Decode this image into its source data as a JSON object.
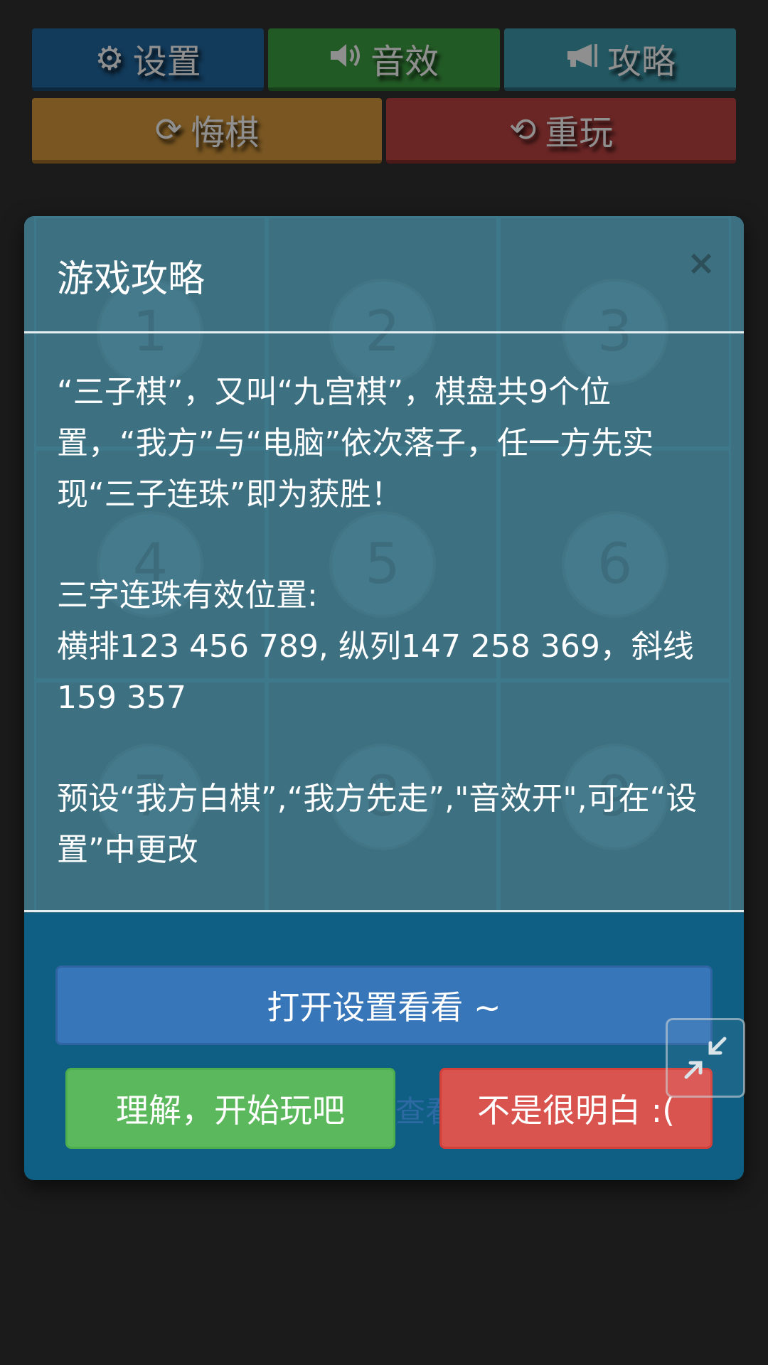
{
  "toolbar": {
    "settings": {
      "label": "设置",
      "icon": "gear-icon"
    },
    "sound": {
      "label": "音效",
      "icon": "volume-icon"
    },
    "guide": {
      "label": "攻略",
      "icon": "megaphone-icon"
    },
    "undo": {
      "label": "悔棋",
      "icon": "rotate-icon"
    },
    "replay": {
      "label": "重玩",
      "icon": "refresh-icon"
    }
  },
  "board": {
    "cells": [
      "1",
      "2",
      "3",
      "4",
      "5",
      "6",
      "7",
      "8",
      "9"
    ]
  },
  "modal": {
    "title": "游戏攻略",
    "close": "×",
    "paragraph1": "“三子棋”，又叫“九宫棋”，棋盘共9个位置，“我方”与“电脑”依次落子，任一方先实现“三子连珠”即为获胜！",
    "paragraph2_line1": "三字连珠有效位置:",
    "paragraph2_line2": "横排123 456 789, 纵列147 258 369，斜线159 357",
    "paragraph3": "预设“我方白棋”,“我方先走”,\"音效开\",可在“设置”中更改",
    "open_settings": "打开设置看看 ~",
    "understand": "理解，开始玩吧",
    "not_clear": "不是很明白 :(",
    "peek_text": "查看"
  },
  "colors": {
    "background": "#1b1b1b",
    "panel": "#0f5e83",
    "primary": "#3776b8",
    "success": "#5cb85c",
    "danger": "#d9534f"
  }
}
